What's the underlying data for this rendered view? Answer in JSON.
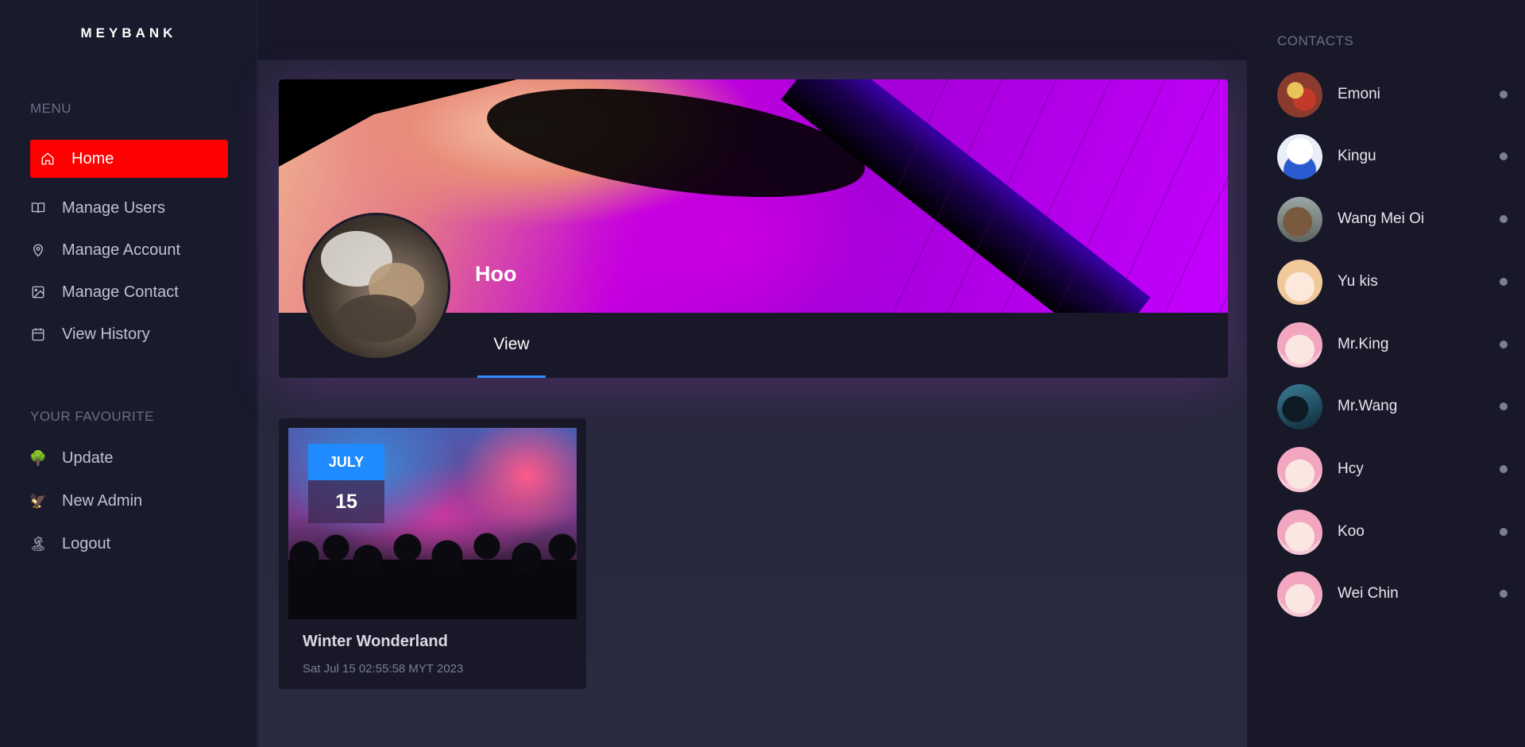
{
  "brand": "MEYBANK",
  "sidebar": {
    "menu_title": "MENU",
    "menu": [
      {
        "label": "Home",
        "icon": "home-icon"
      },
      {
        "label": "Manage Users",
        "icon": "book-icon"
      },
      {
        "label": "Manage Account",
        "icon": "map-pin-icon"
      },
      {
        "label": "Manage Contact",
        "icon": "image-icon"
      },
      {
        "label": "View History",
        "icon": "calendar-icon"
      }
    ],
    "favourite_title": "YOUR FAVOURITE",
    "favourites": [
      {
        "label": "Update",
        "icon": "tree-icon"
      },
      {
        "label": "New Admin",
        "icon": "eagle-icon"
      },
      {
        "label": "Logout",
        "icon": "palm-tree-icon"
      }
    ],
    "accent_color": "#ff0000"
  },
  "profile": {
    "name": "Hoo",
    "tab_label": "View",
    "tab_color": "#2f8cff"
  },
  "event": {
    "month": "JULY",
    "day": "15",
    "title": "Winter Wonderland",
    "datetime": "Sat Jul 15 02:55:58 MYT 2023",
    "badge_color": "#1f8bff"
  },
  "contacts": {
    "title": "CONTACTS",
    "items": [
      {
        "name": "Emoni"
      },
      {
        "name": "Kingu"
      },
      {
        "name": "Wang Mei Oi"
      },
      {
        "name": "Yu kis"
      },
      {
        "name": "Mr.King"
      },
      {
        "name": "Mr.Wang"
      },
      {
        "name": "Hcy"
      },
      {
        "name": "Koo"
      },
      {
        "name": "Wei Chin"
      }
    ]
  }
}
